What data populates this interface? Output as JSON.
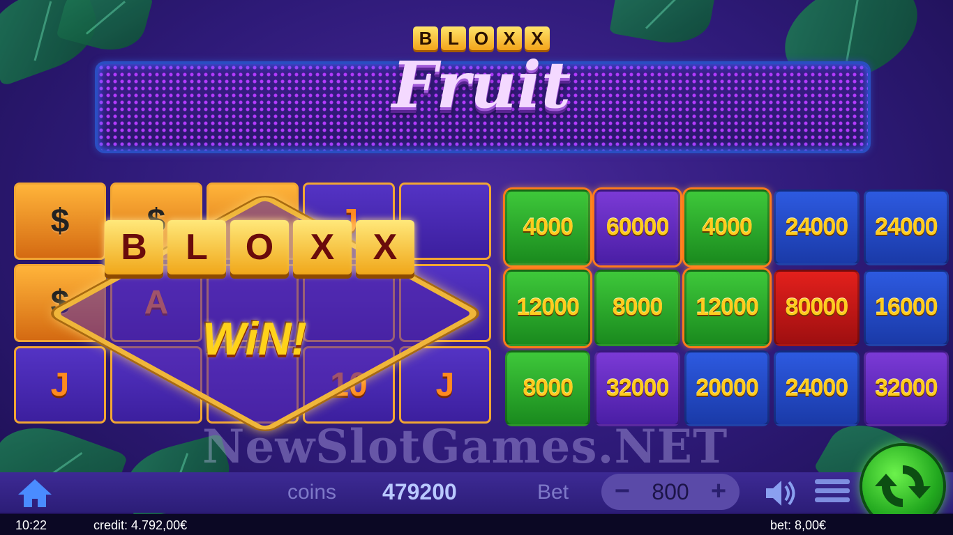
{
  "logo": {
    "top_letters": [
      "B",
      "L",
      "O",
      "X",
      "X"
    ],
    "main": "Fruit"
  },
  "reels": [
    {
      "symbol": "$",
      "style": "gold"
    },
    {
      "symbol": "$",
      "style": "gold"
    },
    {
      "symbol": "",
      "style": "gold"
    },
    {
      "symbol": "J",
      "style": "purple"
    },
    {
      "symbol": "",
      "style": "purple"
    },
    {
      "symbol": "$",
      "style": "gold"
    },
    {
      "symbol": "A",
      "style": "purple"
    },
    {
      "symbol": "",
      "style": "purple"
    },
    {
      "symbol": "",
      "style": "purple"
    },
    {
      "symbol": "",
      "style": "purple"
    },
    {
      "symbol": "J",
      "style": "purple"
    },
    {
      "symbol": "",
      "style": "purple"
    },
    {
      "symbol": "",
      "style": "purple"
    },
    {
      "symbol": "10",
      "style": "purple"
    },
    {
      "symbol": "J",
      "style": "purple"
    }
  ],
  "win_banner": {
    "letters": [
      "B",
      "L",
      "O",
      "X",
      "X"
    ],
    "text": "WiN!"
  },
  "value_grid": [
    {
      "value": "4000",
      "color": "green",
      "hot": true
    },
    {
      "value": "60000",
      "color": "purple",
      "hot": true
    },
    {
      "value": "4000",
      "color": "green",
      "hot": true
    },
    {
      "value": "24000",
      "color": "blue",
      "hot": false
    },
    {
      "value": "24000",
      "color": "blue",
      "hot": false
    },
    {
      "value": "12000",
      "color": "green",
      "hot": true
    },
    {
      "value": "8000",
      "color": "green",
      "hot": false
    },
    {
      "value": "12000",
      "color": "green",
      "hot": true
    },
    {
      "value": "80000",
      "color": "red",
      "hot": false
    },
    {
      "value": "16000",
      "color": "blue",
      "hot": false
    },
    {
      "value": "8000",
      "color": "green",
      "hot": false
    },
    {
      "value": "32000",
      "color": "purple",
      "hot": false
    },
    {
      "value": "20000",
      "color": "blue",
      "hot": false
    },
    {
      "value": "24000",
      "color": "blue",
      "hot": false
    },
    {
      "value": "32000",
      "color": "purple",
      "hot": false
    }
  ],
  "watermark": "NewSlotGames.NET",
  "bottom_bar": {
    "coins_label": "coins",
    "coins_value": "479200",
    "bet_label": "Bet",
    "bet_value": "800",
    "minus": "−",
    "plus": "+"
  },
  "status_bar": {
    "time": "10:22",
    "credit": "credit: 4.792,00€",
    "bet": "bet: 8,00€"
  },
  "icons": {
    "home": "home-icon",
    "sound": "speaker-icon",
    "menu": "hamburger-menu-icon",
    "spin": "spin-arrows-icon"
  }
}
